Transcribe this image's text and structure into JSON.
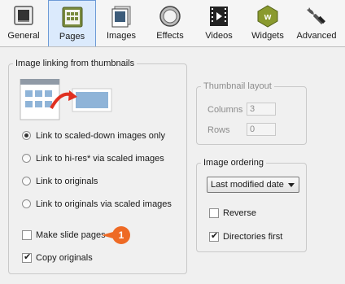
{
  "toolbar": {
    "tabs": [
      {
        "label": "General",
        "icon": "monitor-icon"
      },
      {
        "label": "Pages",
        "icon": "pages-grid-icon"
      },
      {
        "label": "Images",
        "icon": "images-icon"
      },
      {
        "label": "Effects",
        "icon": "lens-icon"
      },
      {
        "label": "Videos",
        "icon": "film-icon"
      },
      {
        "label": "Widgets",
        "icon": "widgets-icon"
      },
      {
        "label": "Advanced",
        "icon": "wrench-icon"
      }
    ],
    "active_tab": "Pages"
  },
  "linking": {
    "legend": "Image linking from thumbnails",
    "options": [
      {
        "label": "Link to scaled-down images only",
        "selected": true
      },
      {
        "label": "Link to hi-res* via scaled images",
        "selected": false
      },
      {
        "label": "Link to originals",
        "selected": false
      },
      {
        "label": "Link to originals via scaled images",
        "selected": false
      }
    ],
    "make_slide_pages": {
      "label": "Make slide pages",
      "checked": false
    },
    "copy_originals": {
      "label": "Copy originals",
      "checked": true
    },
    "callout": "1"
  },
  "thumbnail_layout": {
    "legend": "Thumbnail layout",
    "columns": {
      "label": "Columns",
      "value": "3"
    },
    "rows": {
      "label": "Rows",
      "value": "0"
    }
  },
  "ordering": {
    "legend": "Image ordering",
    "selected": "Last modified date",
    "reverse": {
      "label": "Reverse",
      "checked": false
    },
    "directories_first": {
      "label": "Directories first",
      "checked": true
    }
  },
  "colors": {
    "accent": "#ee6a25",
    "active_tab": "#dbeafc"
  }
}
